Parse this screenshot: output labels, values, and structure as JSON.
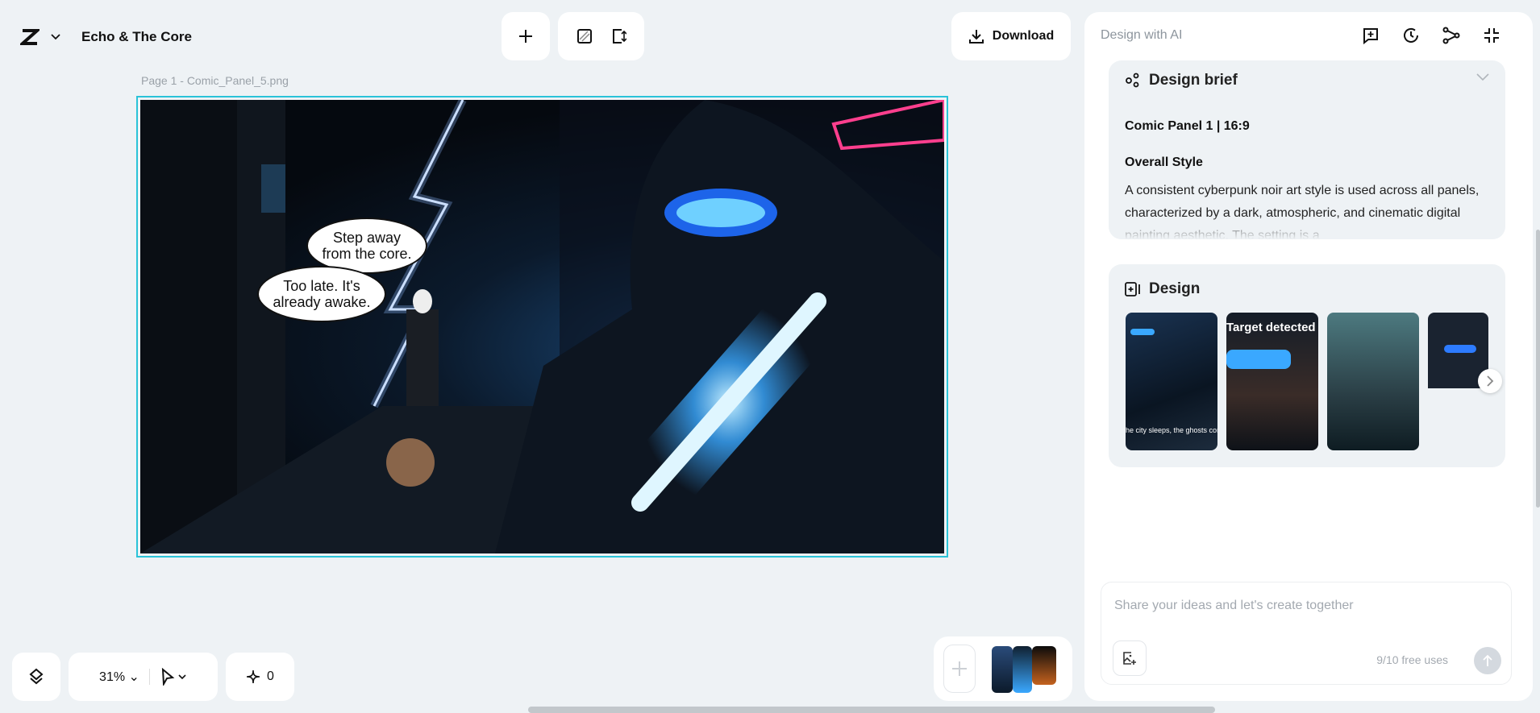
{
  "header": {
    "project_title": "Echo & The Core",
    "download_label": "Download"
  },
  "canvas": {
    "page_label": "Page 1 -  Comic_Panel_5.png",
    "bubble_1": "Step away from the core.",
    "bubble_2": "Too late. It's already awake."
  },
  "bottom": {
    "zoom": "31%",
    "credits": "0"
  },
  "panel": {
    "title": "Design with AI",
    "brief": {
      "heading": "Design brief",
      "subtitle": "Comic Panel 1 | 16:9",
      "section": "Overall Style",
      "text": "A consistent cyberpunk noir art style is used across all panels, characterized by a dark, atmospheric, and cinematic digital painting aesthetic. The setting is a"
    },
    "design": {
      "heading": "Design",
      "thumbs": [
        {
          "caption": "he city sleeps, the ghosts come out"
        },
        {
          "caption": "Target detected"
        },
        {
          "caption": ""
        },
        {
          "caption": ""
        }
      ]
    },
    "input": {
      "placeholder": "Share your ideas and let's create together",
      "uses": "9/10 free uses"
    }
  },
  "colors": {
    "accent": "#2ac3d8",
    "neon_blue": "#3aa8ff",
    "neon_pink": "#ff3f8e"
  }
}
